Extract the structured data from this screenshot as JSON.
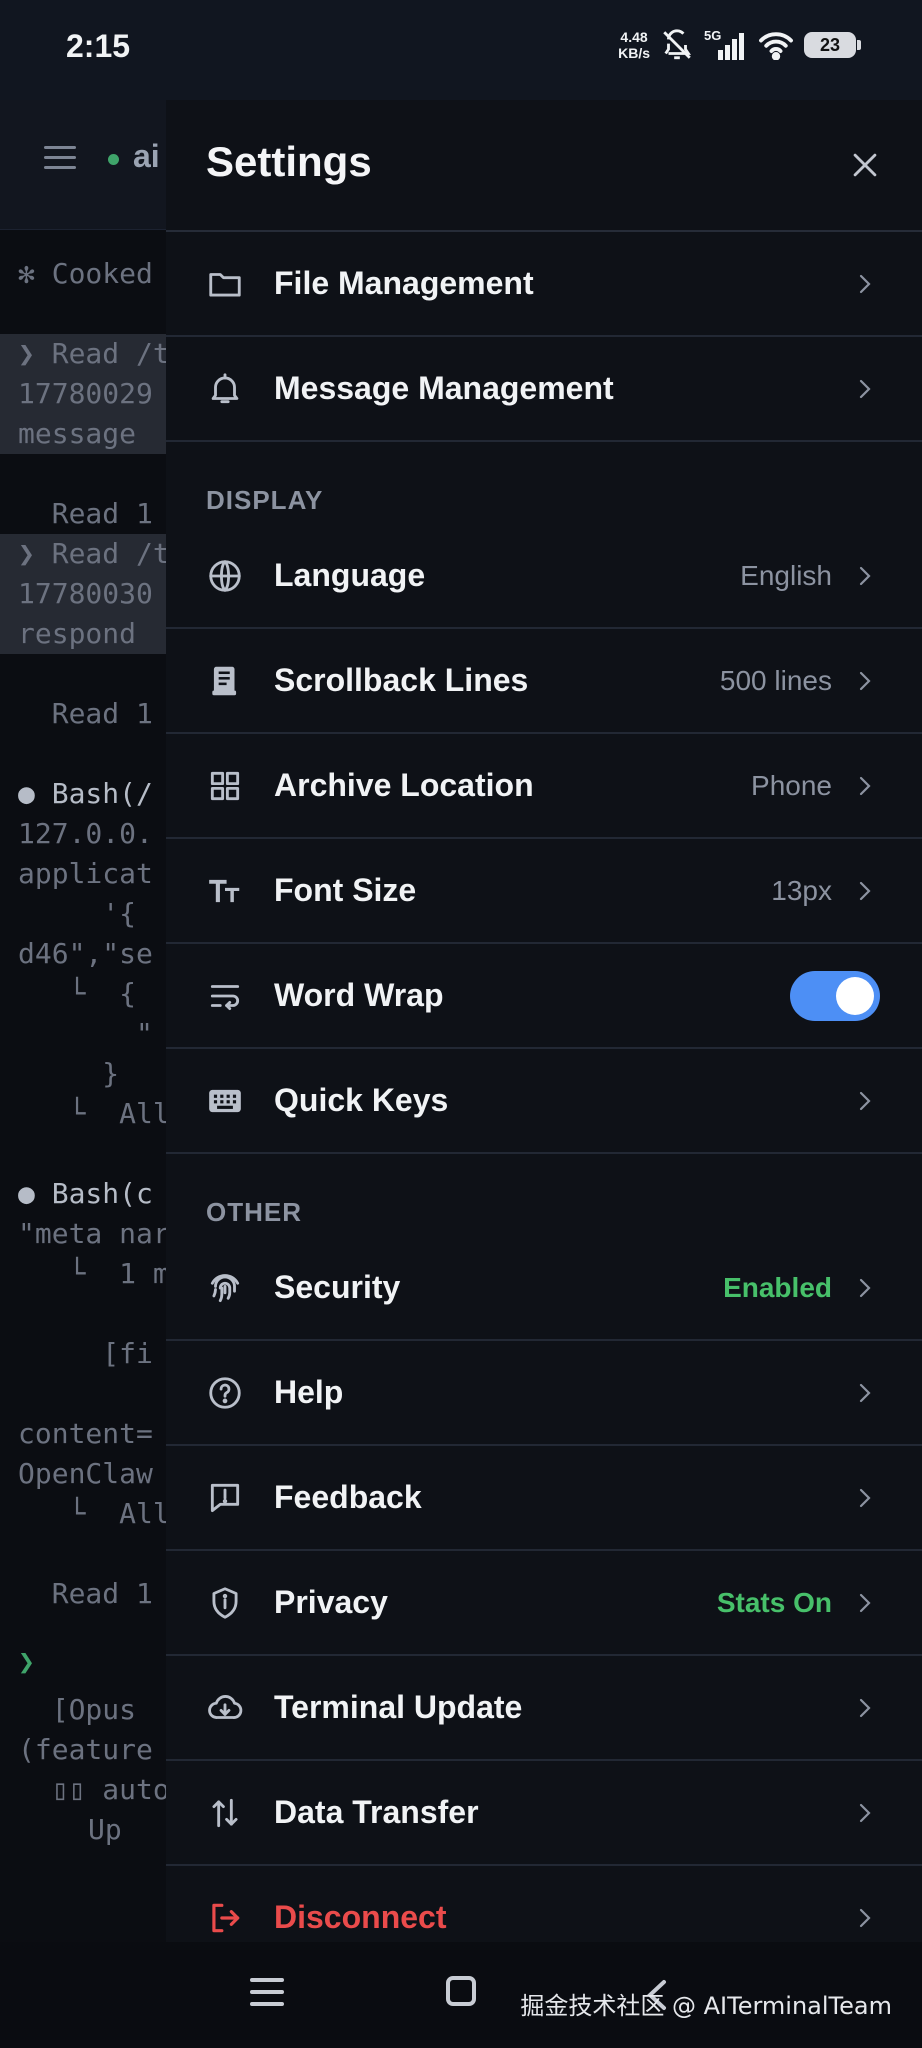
{
  "status_bar": {
    "time": "2:15",
    "net_speed_value": "4.48",
    "net_speed_unit": "KB/s",
    "network": "5G",
    "battery": "23"
  },
  "terminal": {
    "title": "ai",
    "lines": [
      "✻ Cooked",
      "",
      "❯ Read /t",
      "17780029",
      "message",
      "",
      "  Read 1",
      "❯ Read /t",
      "17780030",
      "respond",
      "",
      "  Read 1",
      "",
      "● Bash(/",
      "127.0.0.",
      "applicat",
      "     '{",
      "d46\",\"se",
      "   └  {",
      "       \"",
      "     }",
      "   └  All",
      "",
      "● Bash(c",
      "\"meta nar",
      "   └  1 m",
      "",
      "     [fi",
      "",
      "content=",
      "OpenClaw",
      "   └  All",
      "",
      "  Read 1"
    ],
    "prompt": "❯",
    "footer_lines": [
      "  [Opus",
      "(feature",
      "  ▯▯ auto"
    ],
    "up_label": "Up"
  },
  "settings": {
    "title": "Settings",
    "groups": [
      {
        "section": "",
        "items": [
          {
            "label": "File Management",
            "value": "",
            "icon": "folder-icon"
          },
          {
            "label": "Message Management",
            "value": "",
            "icon": "bell-icon"
          }
        ]
      },
      {
        "section": "DISPLAY",
        "items": [
          {
            "label": "Language",
            "value": "English",
            "icon": "globe-icon"
          },
          {
            "label": "Scrollback Lines",
            "value": "500 lines",
            "icon": "scroll-icon"
          },
          {
            "label": "Archive Location",
            "value": "Phone",
            "icon": "grid-icon"
          },
          {
            "label": "Font Size",
            "value": "13px",
            "icon": "font-size-icon"
          },
          {
            "label": "Word Wrap",
            "value": "",
            "icon": "wrap-icon",
            "toggle": true
          },
          {
            "label": "Quick Keys",
            "value": "",
            "icon": "keyboard-icon"
          }
        ]
      },
      {
        "section": "OTHER",
        "items": [
          {
            "label": "Security",
            "value": "Enabled",
            "icon": "fingerprint-icon"
          },
          {
            "label": "Help",
            "value": "",
            "icon": "help-icon"
          },
          {
            "label": "Feedback",
            "value": "",
            "icon": "feedback-icon"
          },
          {
            "label": "Privacy",
            "value": "Stats On",
            "icon": "shield-icon"
          },
          {
            "label": "Terminal Update",
            "value": "",
            "icon": "cloud-download-icon"
          },
          {
            "label": "Data Transfer",
            "value": "",
            "icon": "transfer-icon"
          },
          {
            "label": "Disconnect",
            "value": "",
            "icon": "logout-icon"
          }
        ]
      }
    ],
    "colors": {
      "accent": "#4d8ff5",
      "enabled_green": "#47c06a",
      "danger": "#ea4b4b"
    }
  },
  "watermark": "掘金技术社区 @ AITerminalTeam"
}
